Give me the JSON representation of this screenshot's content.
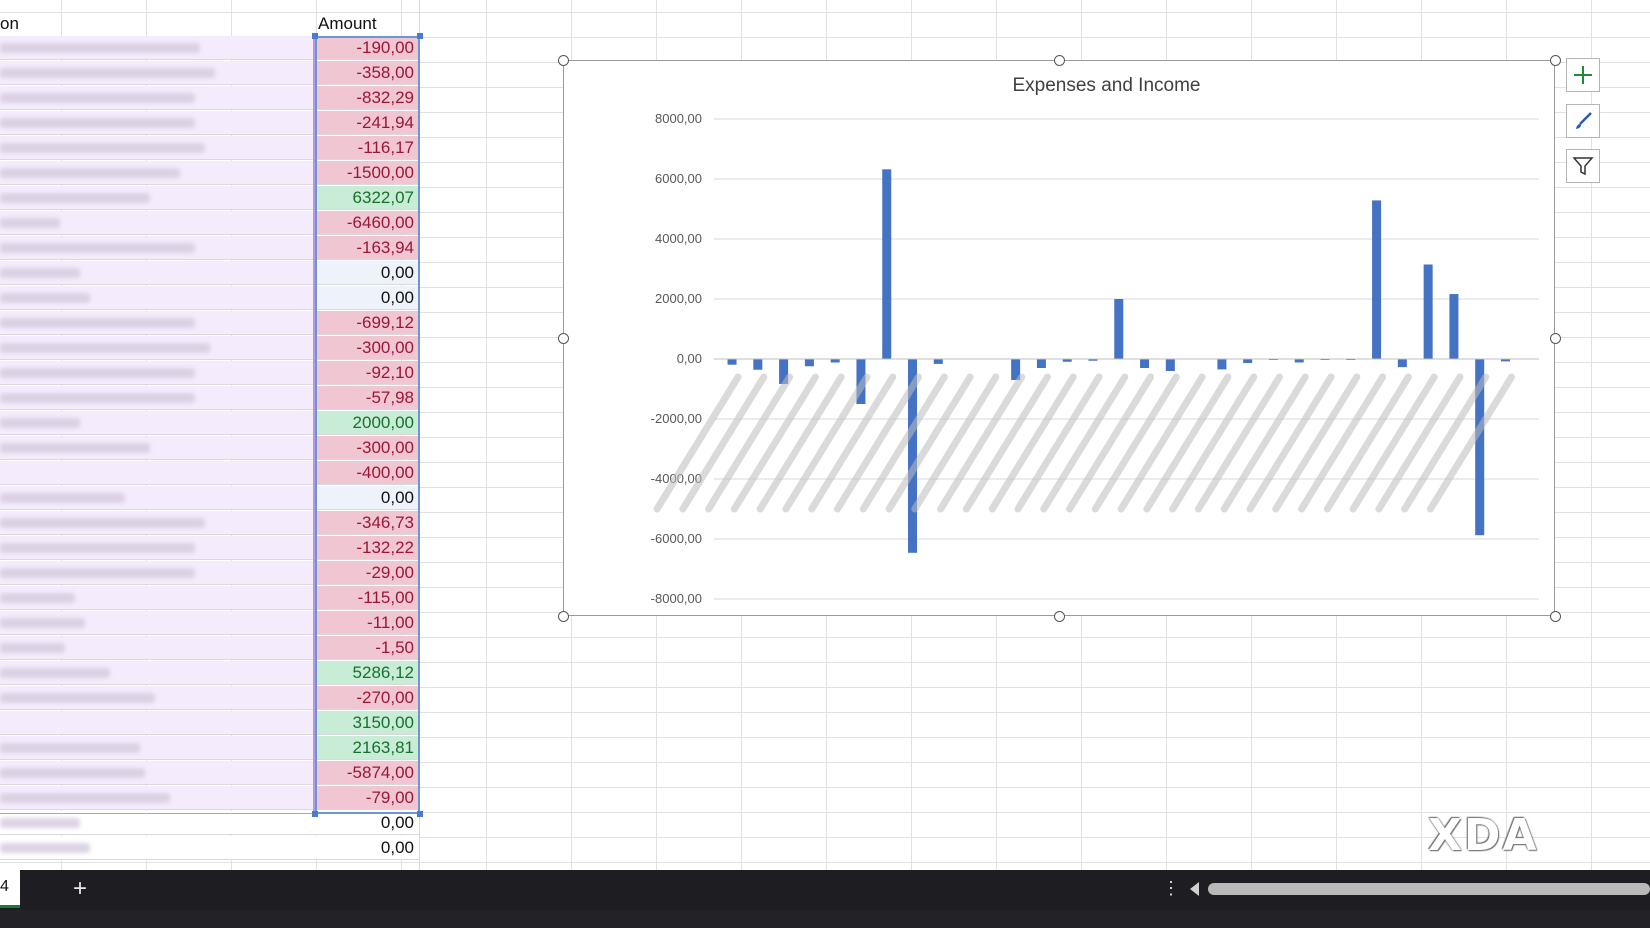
{
  "header": {
    "col_a_label": "on",
    "col_b_label": "Amount"
  },
  "amounts": [
    {
      "value": "-190,00",
      "kind": "neg"
    },
    {
      "value": "-358,00",
      "kind": "neg"
    },
    {
      "value": "-832,29",
      "kind": "neg"
    },
    {
      "value": "-241,94",
      "kind": "neg"
    },
    {
      "value": "-116,17",
      "kind": "neg"
    },
    {
      "value": "-1500,00",
      "kind": "neg"
    },
    {
      "value": "6322,07",
      "kind": "pos"
    },
    {
      "value": "-6460,00",
      "kind": "neg"
    },
    {
      "value": "-163,94",
      "kind": "neg"
    },
    {
      "value": "0,00",
      "kind": "zero"
    },
    {
      "value": "0,00",
      "kind": "zero"
    },
    {
      "value": "-699,12",
      "kind": "neg"
    },
    {
      "value": "-300,00",
      "kind": "neg"
    },
    {
      "value": "-92,10",
      "kind": "neg"
    },
    {
      "value": "-57,98",
      "kind": "neg"
    },
    {
      "value": "2000,00",
      "kind": "pos"
    },
    {
      "value": "-300,00",
      "kind": "neg"
    },
    {
      "value": "-400,00",
      "kind": "neg"
    },
    {
      "value": "0,00",
      "kind": "zero"
    },
    {
      "value": "-346,73",
      "kind": "neg"
    },
    {
      "value": "-132,22",
      "kind": "neg"
    },
    {
      "value": "-29,00",
      "kind": "neg"
    },
    {
      "value": "-115,00",
      "kind": "neg"
    },
    {
      "value": "-11,00",
      "kind": "neg"
    },
    {
      "value": "-1,50",
      "kind": "neg"
    },
    {
      "value": "5286,12",
      "kind": "pos"
    },
    {
      "value": "-270,00",
      "kind": "neg"
    },
    {
      "value": "3150,00",
      "kind": "pos"
    },
    {
      "value": "2163,81",
      "kind": "pos"
    },
    {
      "value": "-5874,00",
      "kind": "neg"
    },
    {
      "value": "-79,00",
      "kind": "neg"
    },
    {
      "value": "0,00",
      "kind": "plainzero"
    },
    {
      "value": "0,00",
      "kind": "plainzero"
    }
  ],
  "chart_data": {
    "type": "bar",
    "title": "Expenses and Income",
    "xlabel": "",
    "ylabel": "",
    "ylim": [
      -8000,
      8000
    ],
    "yticks": [
      "8000,00",
      "6000,00",
      "4000,00",
      "2000,00",
      "0,00",
      "-2000,00",
      "-4000,00",
      "-6000,00",
      "-8000,00"
    ],
    "grid": true,
    "legend": "none",
    "color": "#4472c4",
    "values": [
      -190,
      -358,
      -832.29,
      -241.94,
      -116.17,
      -1500,
      6322.07,
      -6460,
      -163.94,
      0,
      0,
      -699.12,
      -300,
      -92.1,
      -57.98,
      2000,
      -300,
      -400,
      0,
      -346.73,
      -132.22,
      -29,
      -115,
      -11,
      -1.5,
      5286.12,
      -270,
      3150,
      2163.81,
      -5874,
      -79
    ]
  },
  "tabs": {
    "active_label": "4",
    "add_label": "+"
  },
  "watermark": "XDA",
  "icons": {
    "add_element": "plus-icon",
    "style": "brush-icon",
    "filter": "filter-icon",
    "more": "vertical-dots-icon"
  }
}
